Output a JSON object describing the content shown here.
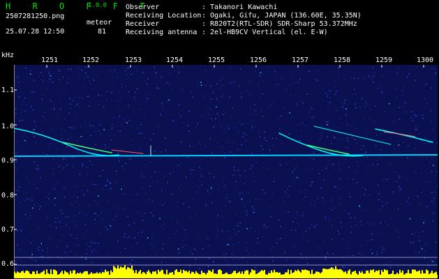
{
  "app": {
    "name": "H R O F F T",
    "version": "1.0.0"
  },
  "file": {
    "name": "2507281250.png",
    "datetime": "25.07.28 12:50"
  },
  "meteor": {
    "label": "meteor",
    "count": "81"
  },
  "info": [
    {
      "key": "Observer",
      "value": ": Takanori Kawachi"
    },
    {
      "key": "Receiving Location",
      "value": ": Ogaki, Gifu, JAPAN (136.60E, 35.35N)"
    },
    {
      "key": "Receiver",
      "value": ": R820T2(RTL-SDR) SDR-Sharp 53.372MHz"
    },
    {
      "key": "Receiving antenna",
      "value": ": 2el-HB9CV Vertical (el. E-W)"
    }
  ],
  "axis": {
    "unit": "kHz",
    "y_ticks": [
      "1.1",
      "1.0",
      "0.9",
      "0.8",
      "0.7",
      "0.6"
    ],
    "x_ticks": [
      "1251",
      "1252",
      "1253",
      "1254",
      "1255",
      "1256",
      "1257",
      "1258",
      "1259",
      "1300"
    ]
  },
  "colors": {
    "background": "#0a1050",
    "noise": "#2a3cc0",
    "trace": "#00ffff",
    "level": "#ffff00",
    "accent": "#00e000"
  }
}
